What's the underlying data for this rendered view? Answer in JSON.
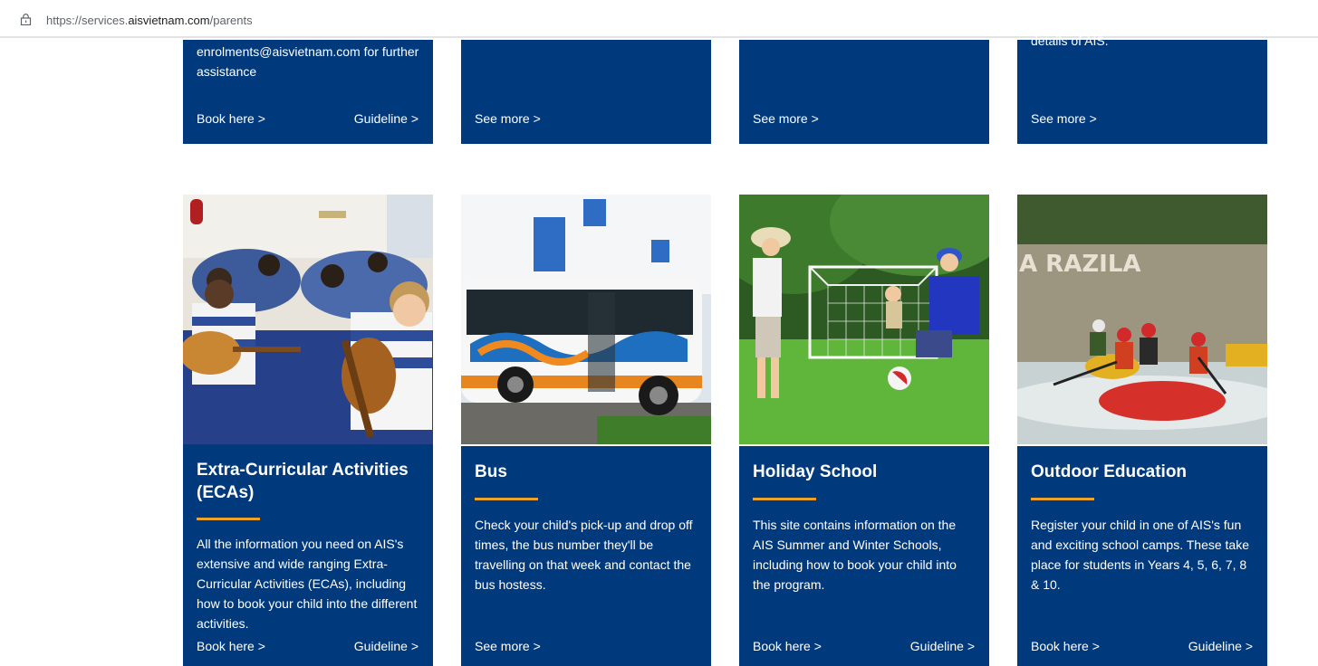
{
  "browser": {
    "url_prefix": "https://services.",
    "url_domain": "aisvietnam.com",
    "url_path": "/parents"
  },
  "top_cards": [
    {
      "text": "enrolments@aisvietnam.com for further assistance",
      "link_left": "Book here >",
      "link_right": "Guideline >"
    },
    {
      "link_left": "See more >"
    },
    {
      "link_left": "See more >"
    },
    {
      "text_fragment": "details of AIS.",
      "link_left": "See more >"
    }
  ],
  "cards": [
    {
      "title": "Extra-Curricular Activities (ECAs)",
      "description": "All the information you need on AIS's extensive and wide ranging Extra-Curricular Activities (ECAs), including how to book your child into the different activities.",
      "link_left": "Book here >",
      "link_right": "Guideline >",
      "image": "students-playing-guitars"
    },
    {
      "title": "Bus",
      "description": "Check your child's pick-up and drop off times, the bus number they'll be travelling on that week and contact the bus hostess.",
      "link_left": "See more >",
      "image": "school-bus"
    },
    {
      "title": "Holiday School",
      "description": "This site contains information on the AIS Summer and Winter Schools, including how to book your child into the program.",
      "link_left": "Book here >",
      "link_right": "Guideline >",
      "image": "children-playing-football"
    },
    {
      "title": "Outdoor Education",
      "description": "Register your child in one of AIS's fun and exciting school camps. These take place for students in Years 4, 5, 6, 7, 8 & 10.",
      "link_left": "Book here >",
      "link_right": "Guideline >",
      "image": "river-rafting",
      "image_sign_text": "A RAZILA"
    }
  ],
  "colors": {
    "card_bg": "#003a7d",
    "accent": "#f0a227"
  }
}
